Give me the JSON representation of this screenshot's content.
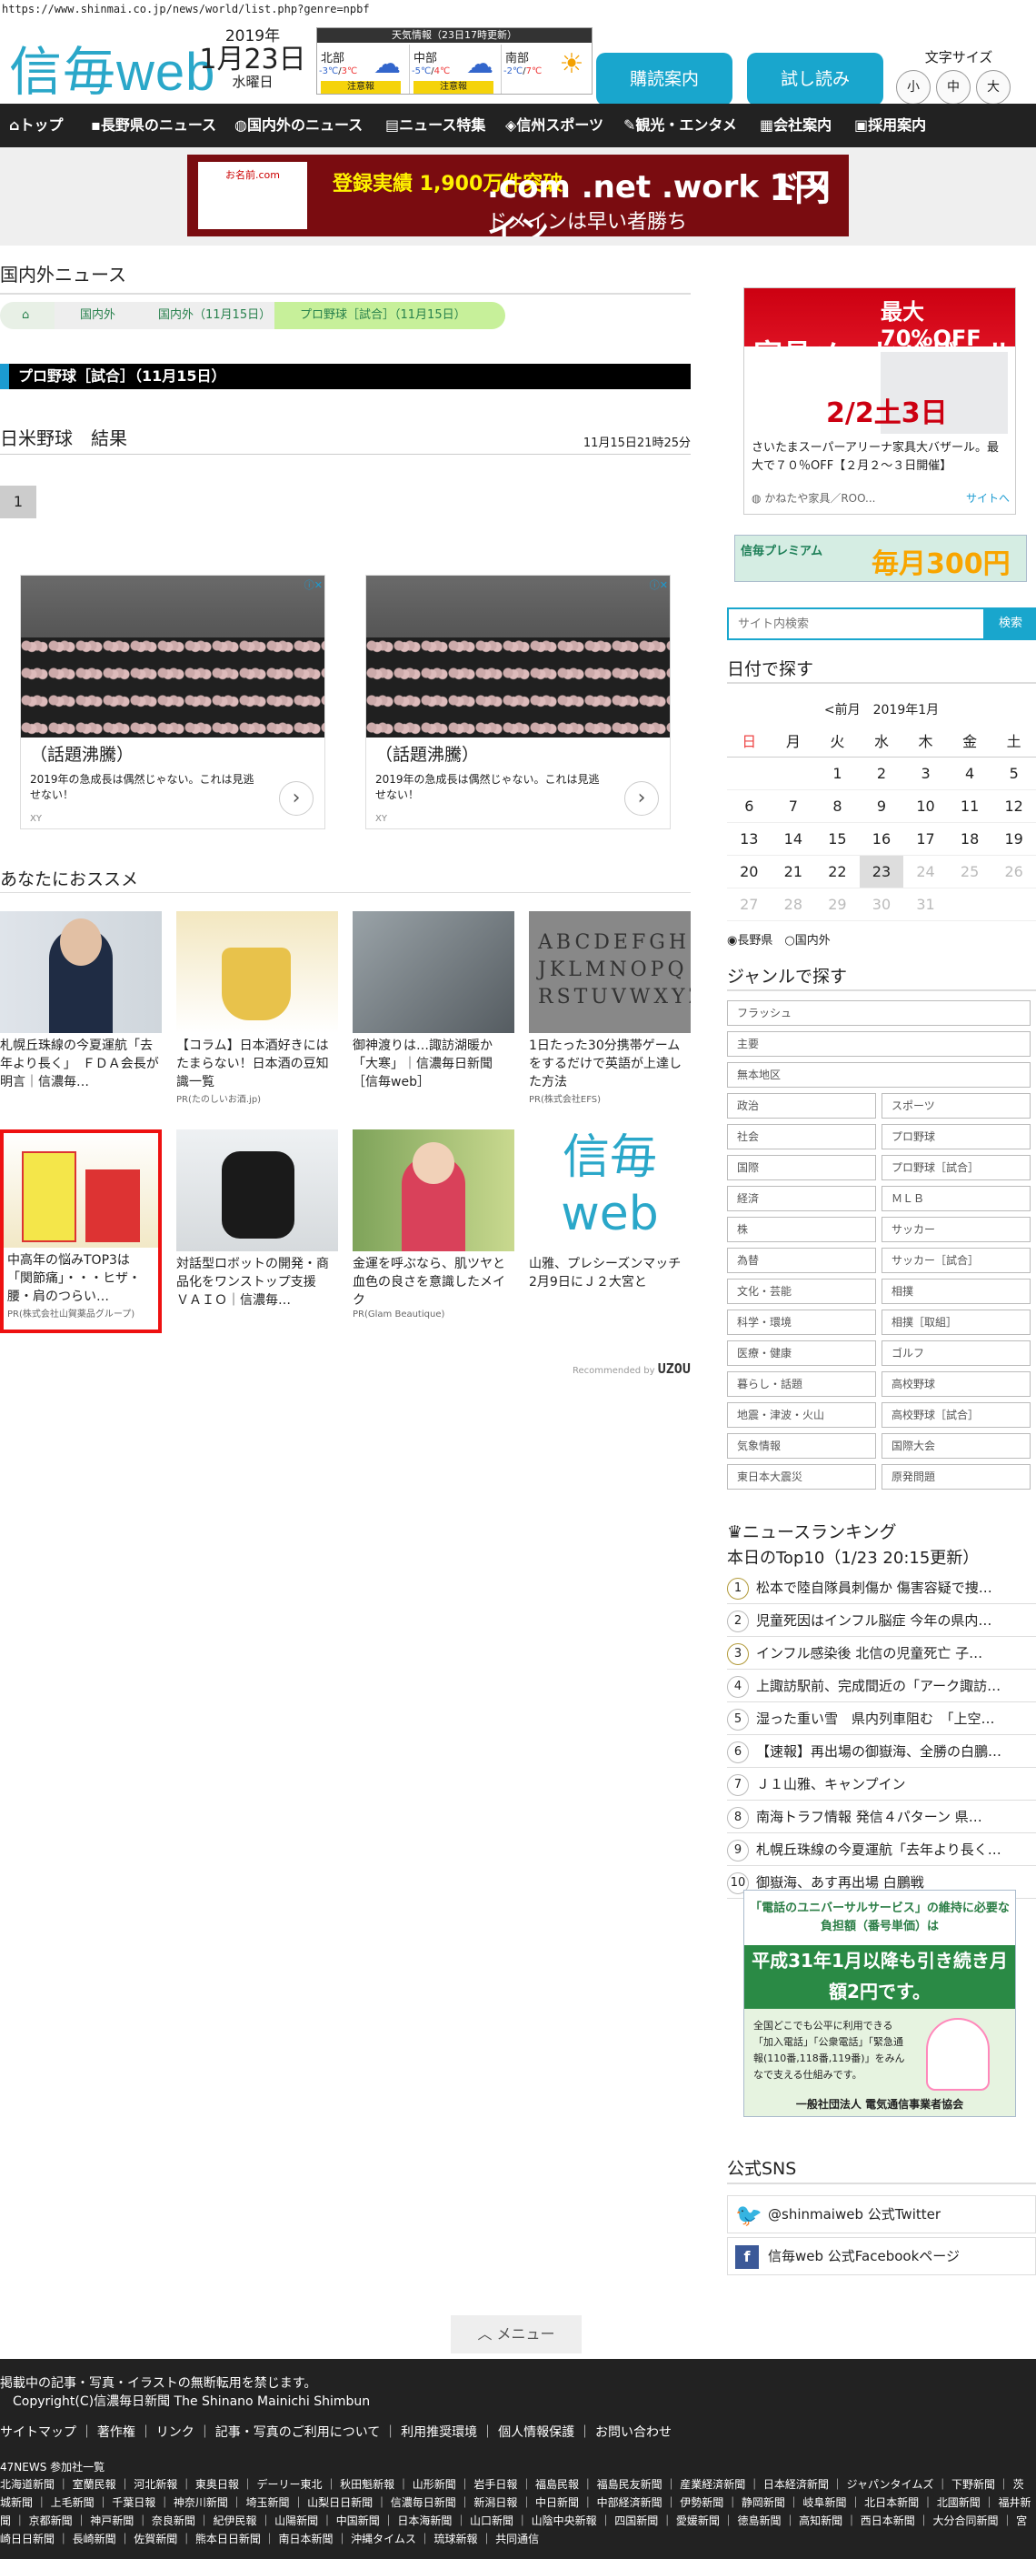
{
  "url": "https://www.shinmai.co.jp/news/world/list.php?genre=npbf",
  "header": {
    "logo": "信毎web",
    "year": "2019年",
    "monthday": "1月23日",
    "weekday": "水曜日",
    "weather_title": "天気情報（23日17時更新）",
    "weather": [
      {
        "name": "北部",
        "hi": "3℃",
        "lo": "-3℃",
        "icon": "☁",
        "badge": "注意報"
      },
      {
        "name": "中部",
        "hi": "4℃",
        "lo": "-5℃",
        "icon": "☁",
        "badge": "注意報"
      },
      {
        "name": "南部",
        "hi": "7℃",
        "lo": "-2℃",
        "icon": "☀",
        "badge": ""
      }
    ],
    "btn_delivery": "購読案内",
    "btn_trial": "試し読み",
    "font_label": "文字サイズ",
    "font_sizes": [
      "小",
      "中",
      "大"
    ]
  },
  "nav": [
    "トップ",
    "長野県のニュース",
    "国内外のニュース",
    "ニュース特集",
    "信州スポーツ",
    "観光・エンタメ",
    "会社案内",
    "採用案内"
  ],
  "ad_top": {
    "box": "お名前.com",
    "t1": "登録実績 1,900万件突破",
    "t2": ".com .net .work ドメイン",
    "t3": "ドメインは早い者勝ち",
    "price": "1円"
  },
  "main": {
    "section_title": "国内外ニュース",
    "breadcrumb": [
      "",
      "国内外",
      "国内外（11月15日）",
      "プロ野球［試合］（11月15日）"
    ],
    "genre_bar": "プロ野球［試合］（11月15日）",
    "article_title": "日米野球　結果",
    "article_date": "11月15日21時25分",
    "page": "1",
    "ads": [
      {
        "label": "（話題沸騰）",
        "text": "2019年の急成長は偶然じゃない。これは見逃せない！",
        "src": "XY"
      },
      {
        "label": "（話題沸騰）",
        "text": "2019年の急成長は偶然じゃない。これは見逃せない！",
        "src": "XY"
      }
    ],
    "rec_title": "あなたにおススメ",
    "recs": [
      {
        "title": "札幌丘珠線の今夏運航「去年より長く」　ＦＤＡ会長が明言｜信濃毎…",
        "pr": ""
      },
      {
        "title": "【コラム】日本酒好きにはたまらない！日本酒の豆知識一覧",
        "pr": "PR(たのしいお酒.jp)"
      },
      {
        "title": "御神渡りは…諏訪湖暖か「大寒」｜信濃毎日新聞［信毎web］",
        "pr": ""
      },
      {
        "title": "1日たった30分携帯ゲームをするだけで英語が上達した方法",
        "pr": "PR(株式会社EFS)"
      },
      {
        "title": "中高年の悩みTOP3は「関節痛」・・・ヒザ・腰・肩のつらい…",
        "pr": "PR(株式会社山賀薬品グループ)"
      },
      {
        "title": "対話型ロボットの開発・商品化をワンストップ支援　ＶＡＩＯ｜信濃毎…",
        "pr": ""
      },
      {
        "title": "金運を呼ぶなら、肌ツヤと血色の良さを意識したメイク",
        "pr": "PR(Glam Beautique)"
      },
      {
        "title": "山雅、プレシーズンマッチ　2月9日にＪ２大宮と",
        "pr": ""
      }
    ],
    "rec_by": "Recommended by",
    "rec_by_brand": "UZOU"
  },
  "side": {
    "ad1_text": "さいたまスーパーアリーナ家具大バザール。最大で７０％OFF【２月２～３日開催】",
    "ad1_src": "かねたや家具／ROO...",
    "ad1_site": "サイトへ",
    "ad1_head": "家具メッセバザール",
    "ad1_sub": "最大70%OFF",
    "ad1_date": "2/2土3日",
    "ad2_a": "信毎プレミアム",
    "ad2_b": "毎月300円",
    "search_placeholder": "サイト内検索",
    "search_btn": "検索",
    "date_title": "日付で探す",
    "cal_prev": "<前月",
    "cal_month": "2019年1月",
    "cal_head": [
      "日",
      "月",
      "火",
      "水",
      "木",
      "金",
      "土"
    ],
    "cal_rows": [
      [
        "",
        "",
        "1",
        "2",
        "3",
        "4",
        "5"
      ],
      [
        "6",
        "7",
        "8",
        "9",
        "10",
        "11",
        "12"
      ],
      [
        "13",
        "14",
        "15",
        "16",
        "17",
        "18",
        "19"
      ],
      [
        "20",
        "21",
        "22",
        "23",
        "24",
        "25",
        "26"
      ],
      [
        "27",
        "28",
        "29",
        "30",
        "31",
        "",
        ""
      ]
    ],
    "radio_a": "長野県",
    "radio_b": "国内外",
    "genre_title": "ジャンルで探す",
    "genres_full": [
      "フラッシュ",
      "主要",
      "無本地区"
    ],
    "genres": [
      "政治",
      "スポーツ",
      "社会",
      "プロ野球",
      "国際",
      "プロ野球［試合］",
      "経済",
      "ＭＬＢ",
      "株",
      "サッカー",
      "為替",
      "サッカー［試合］",
      "文化・芸能",
      "相撲",
      "科学・環境",
      "相撲［取組］",
      "医療・健康",
      "ゴルフ",
      "暮らし・話題",
      "高校野球",
      "地震・津波・火山",
      "高校野球［試合］",
      "気象情報",
      "国際大会",
      "東日本大震災",
      "原発問題"
    ],
    "ranking_title": "ニュースランキング",
    "ranking_sub": "本日のTop10（1/23 20:15更新）",
    "ranking": [
      "松本で陸自隊員刺傷か 傷害容疑で捜…",
      "児童死因はインフル脳症 今年の県内…",
      "インフル感染後 北信の児童死亡 子…",
      "上諏訪駅前、完成間近の「アーク諏訪…",
      "湿った重い雪　県内列車阻む　「上空…",
      "【速報】再出場の御嶽海、全勝の白鵬…",
      "Ｊ１山雅、キャンプイン",
      "南海トラフ情報 発信４パターン 県…",
      "札幌丘珠線の今夏運航「去年より長く…",
      "御嶽海、あす再出場 白鵬戦"
    ],
    "ad3_a": "「電話のユニバーサルサービス」の維持に必要な負担額（番号単価）は",
    "ad3_b": "平成31年1月以降も引き続き月額2円です。",
    "ad3_c": "全国どこでも公平に利用できる「加入電話」「公衆電話」「緊急通報(110番,118番,119番)」をみんなで支える仕組みです。",
    "ad3_d": "一般社団法人 電気通信事業者協会",
    "sns_title": "公式SNS",
    "sns_twitter": "@shinmaiweb 公式Twitter",
    "sns_facebook": "信毎web 公式Facebookページ"
  },
  "menu_btn": "メニュー",
  "footer": {
    "l1": "掲載中の記事・写真・イラストの無断転用を禁じます。",
    "l2": "Copyright(C)信濃毎日新聞 The Shinano Mainichi Shimbun",
    "l3": "サイトマップ ｜ 著作権 ｜ リンク ｜ 記事・写真のご利用について ｜ 利用推奨環境 ｜ 個人情報保護 ｜ お問い合わせ",
    "l4": "47NEWS 参加社一覧",
    "l5": "北海道新聞 ｜ 室蘭民報 ｜ 河北新報 ｜ 東奥日報 ｜ デーリー東北 ｜ 秋田魁新報 ｜ 山形新聞 ｜ 岩手日報 ｜ 福島民報 ｜ 福島民友新聞 ｜ 産業経済新聞 ｜ 日本経済新聞 ｜ ジャパンタイムズ ｜ 下野新聞 ｜ 茨城新聞 ｜ 上毛新聞 ｜ 千葉日報 ｜ 神奈川新聞 ｜ 埼玉新聞 ｜ 山梨日日新聞 ｜ 信濃毎日新聞 ｜ 新潟日報 ｜ 中日新聞 ｜ 中部経済新聞 ｜ 伊勢新聞 ｜ 静岡新聞 ｜ 岐阜新聞 ｜ 北日本新聞 ｜ 北國新聞 ｜ 福井新聞 ｜ 京都新聞 ｜ 神戸新聞 ｜ 奈良新聞 ｜ 紀伊民報 ｜ 山陽新聞 ｜ 中国新聞 ｜ 日本海新聞 ｜ 山口新聞 ｜ 山陰中央新報 ｜ 四国新聞 ｜ 愛媛新聞 ｜ 徳島新聞 ｜ 高知新聞 ｜ 西日本新聞 ｜ 大分合同新聞 ｜ 宮崎日日新聞 ｜ 長崎新聞 ｜ 佐賀新聞 ｜ 熊本日日新聞 ｜ 南日本新聞 ｜ 沖縄タイムス ｜ 琉球新報 ｜ 共同通信"
  }
}
